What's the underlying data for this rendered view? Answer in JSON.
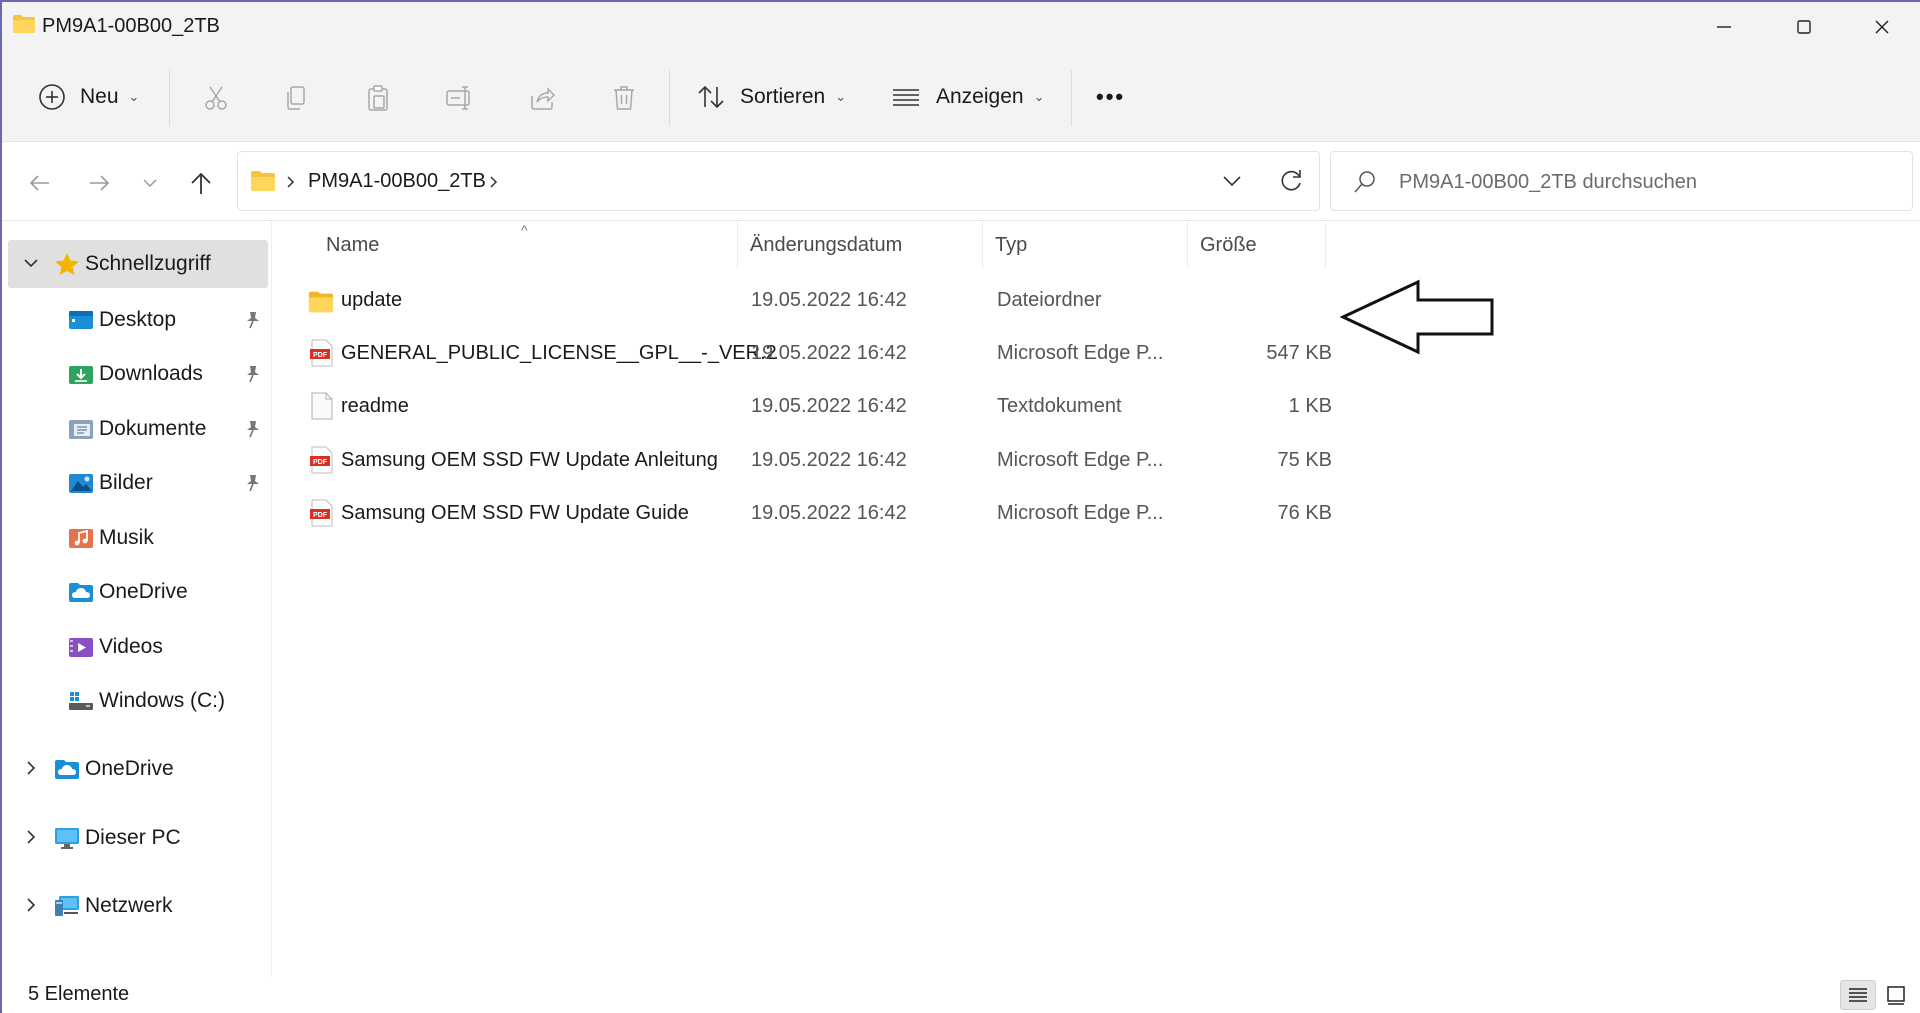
{
  "window": {
    "title": "PM9A1-00B00_2TB",
    "minimize_icon": "minimize-icon",
    "maximize_icon": "maximize-icon",
    "close_icon": "close-icon"
  },
  "toolbar": {
    "new_label": "Neu",
    "sort_label": "Sortieren",
    "view_label": "Anzeigen",
    "more_label": "•••"
  },
  "address": {
    "path": "PM9A1-00B00_2TB",
    "search_placeholder": "PM9A1-00B00_2TB durchsuchen"
  },
  "sidebar": {
    "quick_access": "Schnellzugriff",
    "items": [
      {
        "label": "Desktop",
        "pinned": true
      },
      {
        "label": "Downloads",
        "pinned": true
      },
      {
        "label": "Dokumente",
        "pinned": true
      },
      {
        "label": "Bilder",
        "pinned": true
      },
      {
        "label": "Musik",
        "pinned": false
      },
      {
        "label": "OneDrive",
        "pinned": false
      },
      {
        "label": "Videos",
        "pinned": false
      },
      {
        "label": "Windows (C:)",
        "pinned": false
      }
    ],
    "roots": [
      {
        "label": "OneDrive"
      },
      {
        "label": "Dieser PC"
      },
      {
        "label": "Netzwerk"
      }
    ]
  },
  "columns": {
    "name": "Name",
    "date": "Änderungsdatum",
    "type": "Typ",
    "size": "Größe"
  },
  "files": [
    {
      "name": "update",
      "date": "19.05.2022 16:42",
      "type": "Dateiordner",
      "size": "",
      "icon": "folder-icon"
    },
    {
      "name": "GENERAL_PUBLIC_LICENSE__GPL__-_VER.2",
      "date": "19.05.2022 16:42",
      "type": "Microsoft Edge P...",
      "size": "547 KB",
      "icon": "pdf-icon"
    },
    {
      "name": "readme",
      "date": "19.05.2022 16:42",
      "type": "Textdokument",
      "size": "1 KB",
      "icon": "text-file-icon"
    },
    {
      "name": "Samsung OEM SSD FW Update Anleitung",
      "date": "19.05.2022 16:42",
      "type": "Microsoft Edge P...",
      "size": "75 KB",
      "icon": "pdf-icon"
    },
    {
      "name": "Samsung OEM SSD FW Update Guide",
      "date": "19.05.2022 16:42",
      "type": "Microsoft Edge P...",
      "size": "76 KB",
      "icon": "pdf-icon"
    }
  ],
  "status": {
    "count": "5 Elemente"
  },
  "colors": {
    "accent": "#0067c0",
    "folder": "#f5c542",
    "pdf": "#d93025",
    "selected_bg": "#e0e0e0"
  }
}
